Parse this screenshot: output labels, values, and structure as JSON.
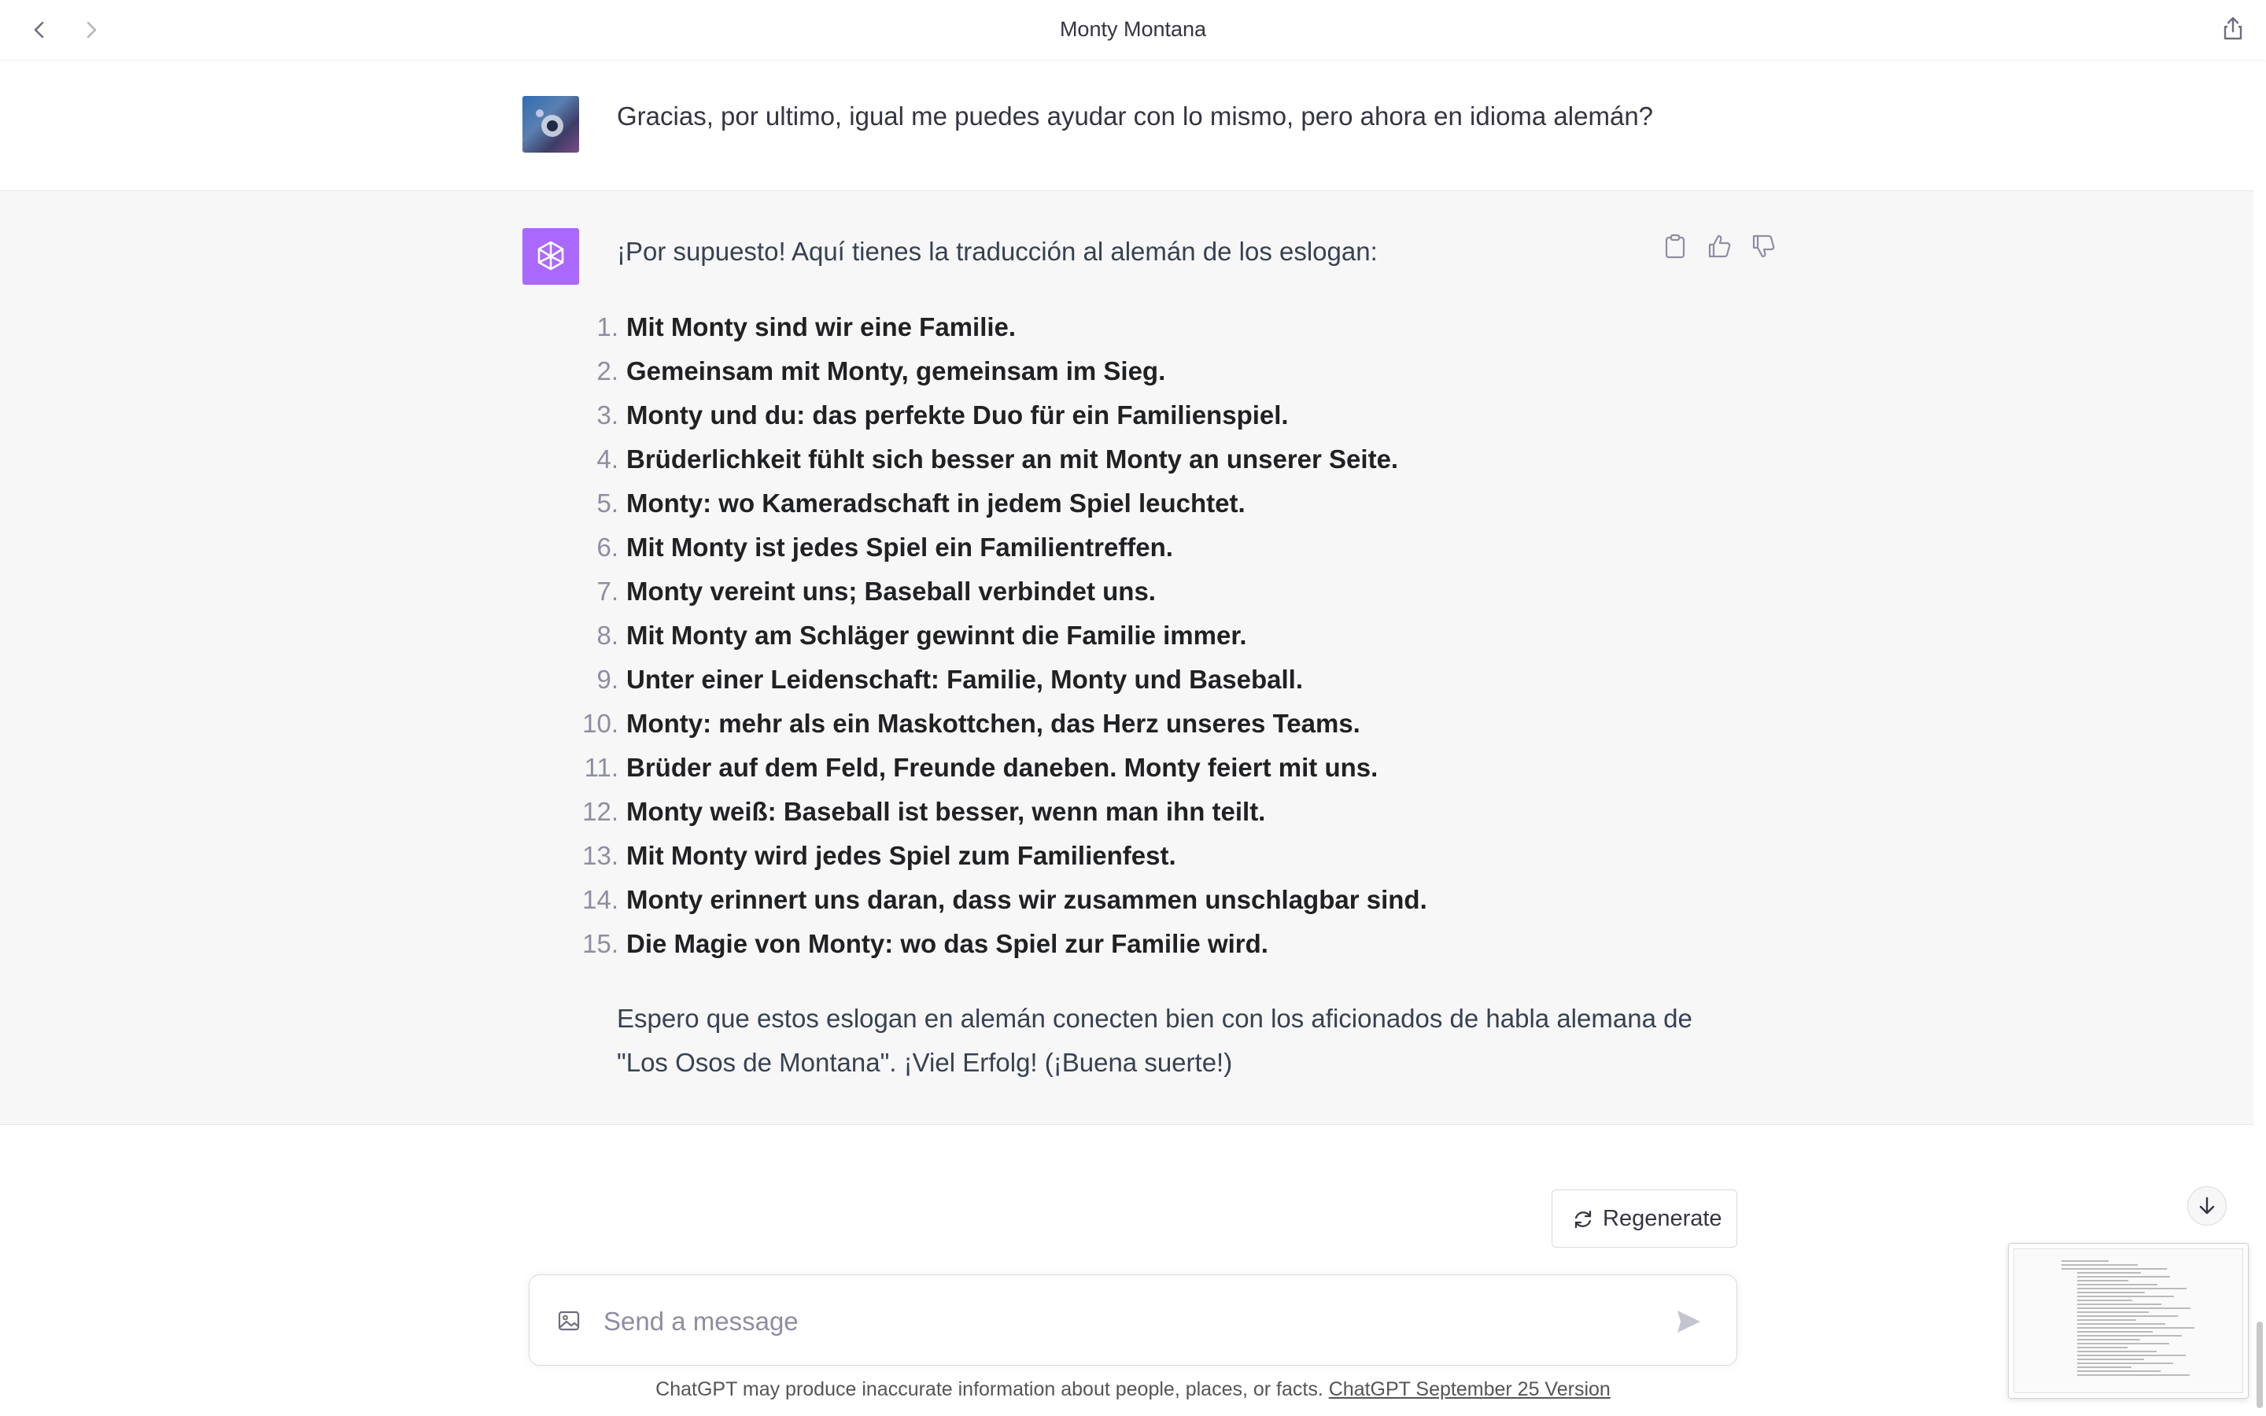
{
  "window": {
    "title": "Monty Montana"
  },
  "user_message": {
    "text": "Gracias, por ultimo, igual me puedes ayudar con lo mismo, pero ahora en idioma alemán?"
  },
  "assistant_message": {
    "intro": "¡Por supuesto! Aquí tienes la traducción al alemán de los eslogan:",
    "slogans": [
      {
        "num": "1.",
        "text": "Mit Monty sind wir eine Familie."
      },
      {
        "num": "2.",
        "text": "Gemeinsam mit Monty, gemeinsam im Sieg."
      },
      {
        "num": "3.",
        "text": "Monty und du: das perfekte Duo für ein Familienspiel."
      },
      {
        "num": "4.",
        "text": "Brüderlichkeit fühlt sich besser an mit Monty an unserer Seite."
      },
      {
        "num": "5.",
        "text": "Monty: wo Kameradschaft in jedem Spiel leuchtet."
      },
      {
        "num": "6.",
        "text": "Mit Monty ist jedes Spiel ein Familientreffen."
      },
      {
        "num": "7.",
        "text": "Monty vereint uns; Baseball verbindet uns."
      },
      {
        "num": "8.",
        "text": "Mit Monty am Schläger gewinnt die Familie immer."
      },
      {
        "num": "9.",
        "text": "Unter einer Leidenschaft: Familie, Monty und Baseball."
      },
      {
        "num": "10.",
        "text": "Monty: mehr als ein Maskottchen, das Herz unseres Teams."
      },
      {
        "num": "11.",
        "text": "Brüder auf dem Feld, Freunde daneben. Monty feiert mit uns."
      },
      {
        "num": "12.",
        "text": "Monty weiß: Baseball ist besser, wenn man ihn teilt."
      },
      {
        "num": "13.",
        "text": "Mit Monty wird jedes Spiel zum Familienfest."
      },
      {
        "num": "14.",
        "text": "Monty erinnert uns daran, dass wir zusammen unschlagbar sind."
      },
      {
        "num": "15.",
        "text": "Die Magie von Monty: wo das Spiel zur Familie wird."
      }
    ],
    "outro": "Espero que estos eslogan en alemán conecten bien con los aficionados de habla alemana de \"Los Osos de Montana\". ¡Viel Erfolg! (¡Buena suerte!)"
  },
  "controls": {
    "regenerate_label": "Regenerate"
  },
  "composer": {
    "placeholder": "Send a message"
  },
  "footer": {
    "disclaimer": "ChatGPT may produce inaccurate information about people, places, or facts.",
    "version_link": "ChatGPT September 25 Version"
  },
  "icons": {
    "back": "chevron-left-icon",
    "forward": "chevron-right-icon",
    "share": "share-icon",
    "sidebar": "sidebar-toggle-icon",
    "copy": "clipboard-icon",
    "like": "thumbs-up-icon",
    "dislike": "thumbs-down-icon",
    "regenerate": "refresh-icon",
    "image": "image-icon",
    "send": "send-icon",
    "scroll": "arrow-down-icon"
  },
  "colors": {
    "assistant_avatar": "#ab68ff",
    "assistant_bg": "#f7f7f8",
    "text": "#343541"
  }
}
